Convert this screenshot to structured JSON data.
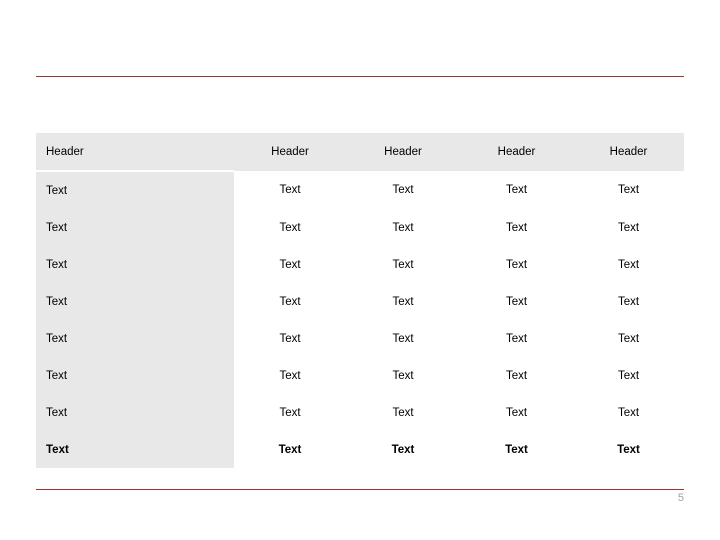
{
  "slide": {
    "page_number": "5",
    "accent_color": "#963634",
    "shade_color": "#E8E8E8"
  },
  "table": {
    "columns": [
      "Header",
      "Header",
      "Header",
      "Header",
      "Header"
    ],
    "rows": [
      {
        "cells": [
          "Text",
          "Text",
          "Text",
          "Text",
          "Text"
        ],
        "bold": false,
        "shaded": false
      },
      {
        "cells": [
          "Text",
          "Text",
          "Text",
          "Text",
          "Text"
        ],
        "bold": false,
        "shaded": false
      },
      {
        "cells": [
          "Text",
          "Text",
          "Text",
          "Text",
          "Text"
        ],
        "bold": false,
        "shaded": false
      },
      {
        "cells": [
          "Text",
          "Text",
          "Text",
          "Text",
          "Text"
        ],
        "bold": false,
        "shaded": false
      },
      {
        "cells": [
          "Text",
          "Text",
          "Text",
          "Text",
          "Text"
        ],
        "bold": false,
        "shaded": false
      },
      {
        "cells": [
          "Text",
          "Text",
          "Text",
          "Text",
          "Text"
        ],
        "bold": false,
        "shaded": false
      },
      {
        "cells": [
          "Text",
          "Text",
          "Text",
          "Text",
          "Text"
        ],
        "bold": false,
        "shaded": false
      },
      {
        "cells": [
          "Text",
          "Text",
          "Text",
          "Text",
          "Text"
        ],
        "bold": true,
        "shaded": false
      }
    ]
  }
}
